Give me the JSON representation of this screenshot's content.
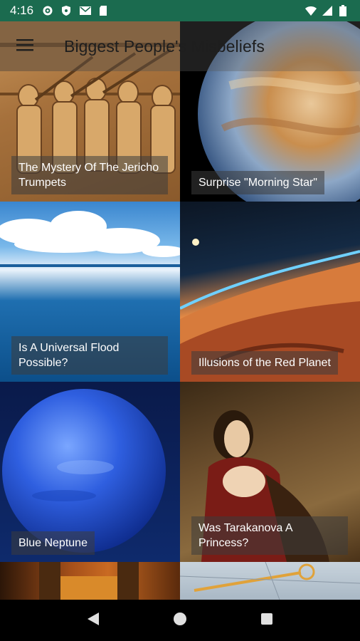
{
  "status_bar": {
    "time": "4:16",
    "icons_left": [
      "gear-icon",
      "shield-icon",
      "mail-icon",
      "sd-card-icon"
    ],
    "icons_right": [
      "wifi-icon",
      "signal-icon",
      "battery-icon"
    ]
  },
  "app_bar": {
    "title": "Biggest People's Misbeliefs",
    "menu_icon": "hamburger-menu-icon"
  },
  "articles": [
    {
      "title": "The Mystery Of The Jericho Trumpets"
    },
    {
      "title": "Surprise \"Morning Star\""
    },
    {
      "title": "Is A Universal Flood Possible?"
    },
    {
      "title": "Illusions of the Red Planet"
    },
    {
      "title": "Blue Neptune"
    },
    {
      "title": "Was Tarakanova A Princess?"
    }
  ],
  "nav_bar": {
    "buttons": [
      "back-icon",
      "home-icon",
      "recents-icon"
    ]
  },
  "colors": {
    "status_bar": "#1b6b4f",
    "caption_bg": "rgba(60,60,60,0.55)",
    "title_text": "#1e1e1e"
  }
}
